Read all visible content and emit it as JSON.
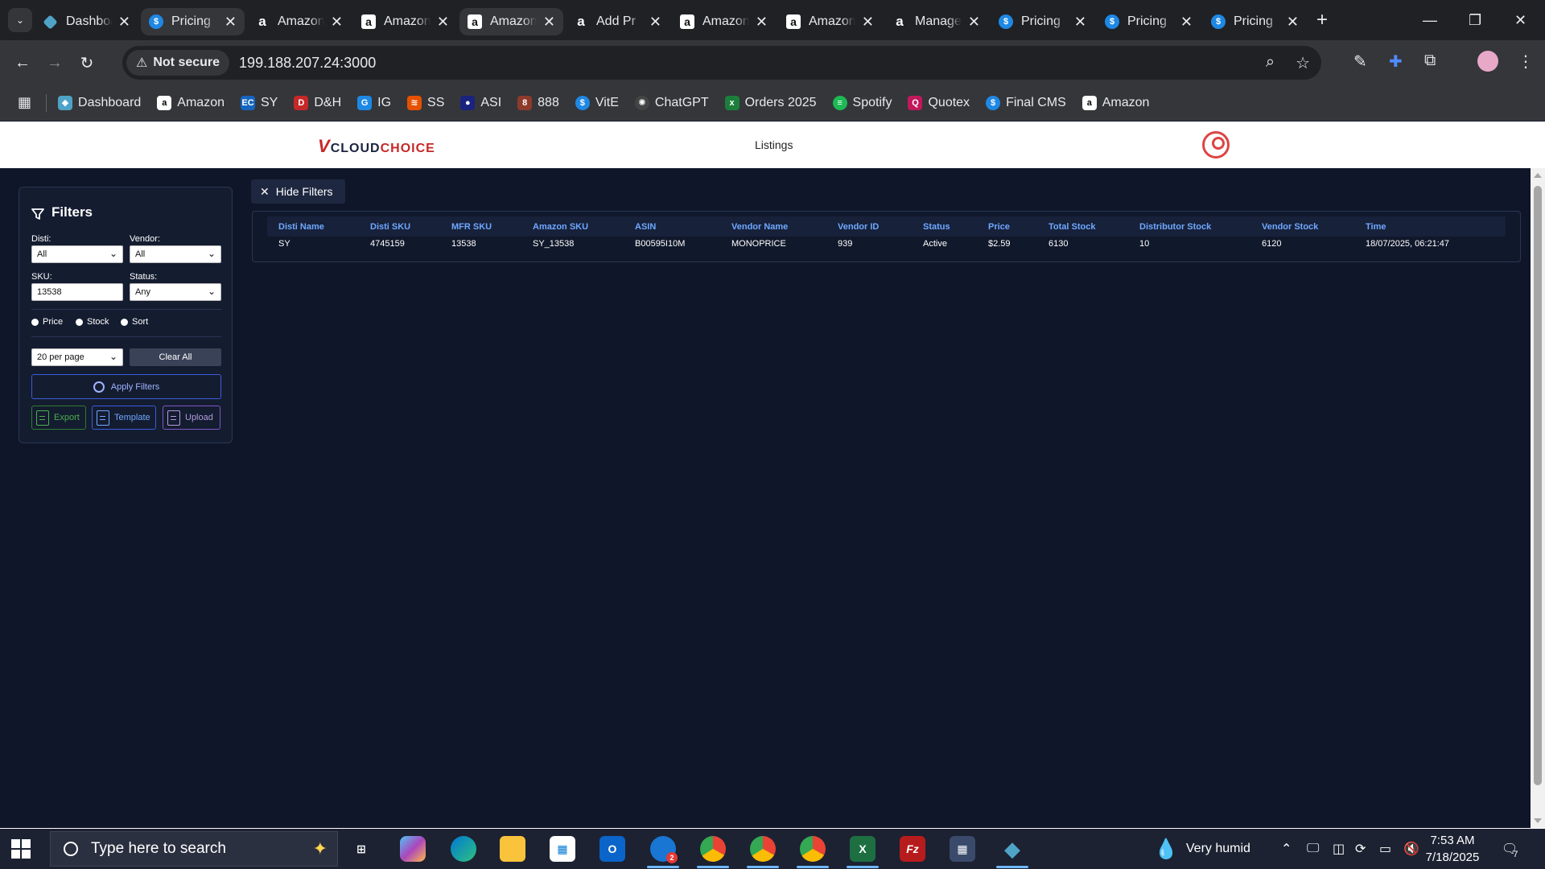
{
  "browser": {
    "tabs": [
      {
        "title": "Dashboard",
        "icon": "dashboard-icon"
      },
      {
        "title": "Pricing",
        "icon": "dollar-icon",
        "active": true
      },
      {
        "title": "Amazon",
        "icon": "amazon-icon"
      },
      {
        "title": "Amazon",
        "icon": "amazon-icon"
      },
      {
        "title": "Amazon",
        "icon": "amazon-icon"
      },
      {
        "title": "Add Pr",
        "icon": "amazon-icon"
      },
      {
        "title": "Amazon",
        "icon": "amazon-icon"
      },
      {
        "title": "Amazon",
        "icon": "amazon-icon"
      },
      {
        "title": "Manage",
        "icon": "amazon-icon"
      },
      {
        "title": "Pricing",
        "icon": "dollar-icon"
      },
      {
        "title": "Pricing",
        "icon": "dollar-icon"
      },
      {
        "title": "Pricing",
        "icon": "dollar-icon"
      }
    ],
    "security_label": "Not secure",
    "url": "199.188.207.24:3000",
    "bookmarks": [
      {
        "label": "Dashboard",
        "color": "#4fa3c7"
      },
      {
        "label": "Amazon",
        "color": "#000000"
      },
      {
        "label": "SY",
        "color": "#1565c0"
      },
      {
        "label": "D&H",
        "color": "#c62828"
      },
      {
        "label": "IG",
        "color": "#1e88e5"
      },
      {
        "label": "SS",
        "color": "#e65100"
      },
      {
        "label": "ASI",
        "color": "#1a237e"
      },
      {
        "label": "888",
        "color": "#8d3b2b"
      },
      {
        "label": "VitE",
        "color": "#1e88e5"
      },
      {
        "label": "ChatGPT",
        "color": "#444444"
      },
      {
        "label": "Orders 2025",
        "color": "#1b7f3b"
      },
      {
        "label": "Spotify",
        "color": "#1db954"
      },
      {
        "label": "Quotex",
        "color": "#c2185b"
      },
      {
        "label": "Final CMS",
        "color": "#1e88e5"
      },
      {
        "label": "Amazon",
        "color": "#000000"
      }
    ]
  },
  "app": {
    "logo_v": "V",
    "logo_text_1": "CLOUD",
    "logo_text_2": "CHOICE",
    "nav_listings": "Listings"
  },
  "filters": {
    "title": "Filters",
    "disti_label": "Disti:",
    "disti_value": "All",
    "vendor_label": "Vendor:",
    "vendor_value": "All",
    "sku_label": "SKU:",
    "sku_value": "13538",
    "status_label": "Status:",
    "status_value": "Any",
    "radio_price": "Price",
    "radio_stock": "Stock",
    "radio_sort": "Sort",
    "per_page": "20 per page",
    "clear_all": "Clear All",
    "apply": "Apply Filters",
    "export": "Export",
    "template": "Template",
    "upload": "Upload"
  },
  "hide_filters": "Hide Filters",
  "table": {
    "columns": [
      "Disti Name",
      "Disti SKU",
      "MFR SKU",
      "Amazon SKU",
      "ASIN",
      "Vendor Name",
      "Vendor ID",
      "Status",
      "Price",
      "Total Stock",
      "Distributor Stock",
      "Vendor Stock",
      "Time"
    ],
    "rows": [
      [
        "SY",
        "4745159",
        "13538",
        "SY_13538",
        "B00595I10M",
        "MONOPRICE",
        "939",
        "Active",
        "$2.59",
        "6130",
        "10",
        "6120",
        "18/07/2025, 06:21:47"
      ]
    ]
  },
  "taskbar": {
    "search_placeholder": "Type here to search",
    "weather": "Very humid",
    "time": "7:53 AM",
    "date": "7/18/2025",
    "notification_count": "7",
    "outlook_badge": "2"
  }
}
